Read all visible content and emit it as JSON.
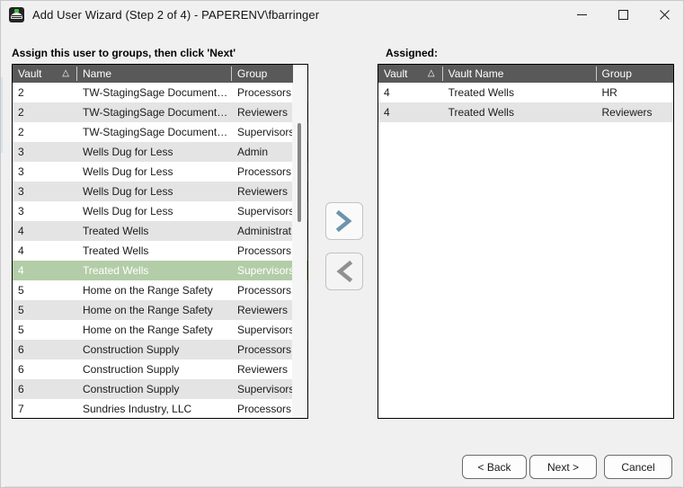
{
  "window": {
    "title": "Add User Wizard (Step 2 of 4) - PAPERENV\\fbarringer",
    "icon": "app-icon",
    "controls": {
      "minimize": "minimize-icon",
      "maximize": "maximize-icon",
      "close": "close-icon"
    }
  },
  "left_panel": {
    "label": "Assign this user to groups, then click 'Next'",
    "columns": [
      "Vault",
      "Name",
      "Group"
    ],
    "sort_indicator": "△",
    "rows": [
      {
        "vault": "2",
        "name": "TW-StagingSage Documents Test",
        "group": "Processors",
        "selected": false
      },
      {
        "vault": "2",
        "name": "TW-StagingSage Documents Test",
        "group": "Reviewers",
        "selected": false
      },
      {
        "vault": "2",
        "name": "TW-StagingSage Documents Test",
        "group": "Supervisors",
        "selected": false
      },
      {
        "vault": "3",
        "name": "Wells Dug for Less",
        "group": "Admin",
        "selected": false
      },
      {
        "vault": "3",
        "name": "Wells Dug for Less",
        "group": "Processors",
        "selected": false
      },
      {
        "vault": "3",
        "name": "Wells Dug for Less",
        "group": "Reviewers",
        "selected": false
      },
      {
        "vault": "3",
        "name": "Wells Dug for Less",
        "group": "Supervisors",
        "selected": false
      },
      {
        "vault": "4",
        "name": "Treated Wells",
        "group": "Administrat…",
        "selected": false
      },
      {
        "vault": "4",
        "name": "Treated Wells",
        "group": "Processors",
        "selected": false
      },
      {
        "vault": "4",
        "name": "Treated Wells",
        "group": "Supervisors",
        "selected": true
      },
      {
        "vault": "5",
        "name": "Home on the Range Safety",
        "group": "Processors",
        "selected": false
      },
      {
        "vault": "5",
        "name": "Home on the Range Safety",
        "group": "Reviewers",
        "selected": false
      },
      {
        "vault": "5",
        "name": "Home on the Range Safety",
        "group": "Supervisors",
        "selected": false
      },
      {
        "vault": "6",
        "name": "Construction Supply",
        "group": "Processors",
        "selected": false
      },
      {
        "vault": "6",
        "name": "Construction Supply",
        "group": "Reviewers",
        "selected": false
      },
      {
        "vault": "6",
        "name": "Construction Supply",
        "group": "Supervisors",
        "selected": false
      },
      {
        "vault": "7",
        "name": "Sundries Industry, LLC",
        "group": "Processors",
        "selected": false
      }
    ]
  },
  "right_panel": {
    "label": "Assigned:",
    "columns": [
      "Vault",
      "Vault Name",
      "Group"
    ],
    "sort_indicator": "△",
    "rows": [
      {
        "vault": "4",
        "name": "Treated Wells",
        "group": "HR",
        "selected": false
      },
      {
        "vault": "4",
        "name": "Treated Wells",
        "group": "Reviewers",
        "selected": false
      }
    ]
  },
  "transfer_buttons": {
    "add": {
      "icon": "chevron-right-icon",
      "color": "#6d93ac"
    },
    "remove": {
      "icon": "chevron-left-icon",
      "color": "#909090"
    }
  },
  "footer": {
    "back": "< Back",
    "next": "Next >",
    "cancel": "Cancel"
  },
  "colors": {
    "selection_green": "#b3cda8",
    "header_gray": "#595959",
    "row_alt": "#e4e4e4",
    "dialog_bg": "#f0f0f0"
  }
}
